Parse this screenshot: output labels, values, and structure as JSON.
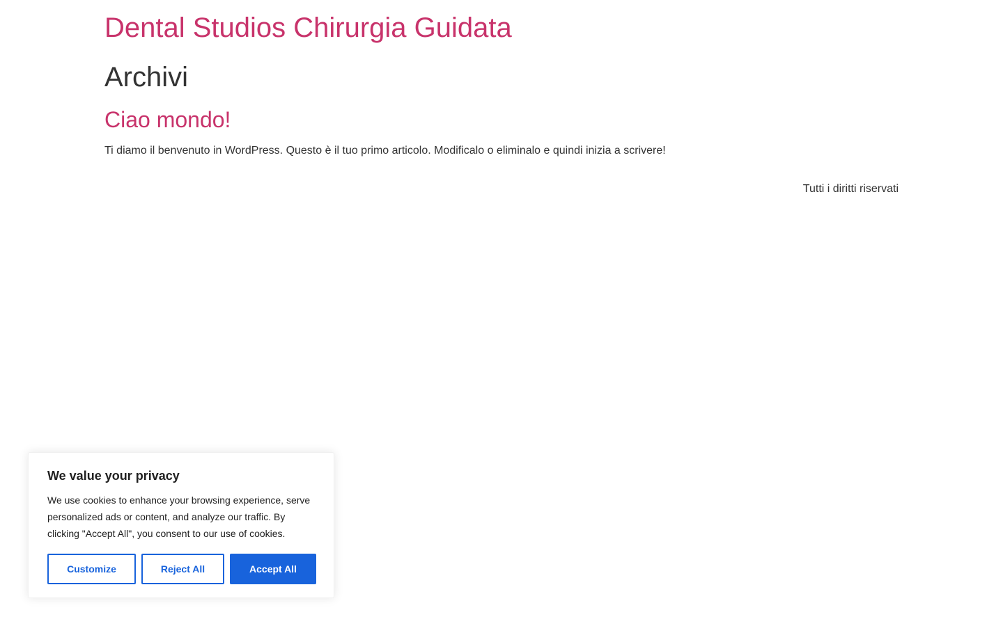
{
  "site": {
    "title": "Dental Studios Chirurgia Guidata"
  },
  "archive": {
    "title": "Archivi"
  },
  "post": {
    "title": "Ciao mondo!",
    "excerpt": "Ti diamo il benvenuto in WordPress. Questo è il tuo primo articolo. Modificalo o eliminalo e quindi inizia a scrivere!"
  },
  "footer": {
    "text": "Tutti i diritti riservati"
  },
  "cookie": {
    "heading": "We value your privacy",
    "text": "We use cookies to enhance your browsing experience, serve personalized ads or content, and analyze our traffic. By clicking \"Accept All\", you consent to our use of cookies.",
    "customize_label": "Customize",
    "reject_label": "Reject All",
    "accept_label": "Accept All"
  },
  "colors": {
    "brand": "#c8336b",
    "button_accent": "#1863dc",
    "text": "#333333"
  }
}
